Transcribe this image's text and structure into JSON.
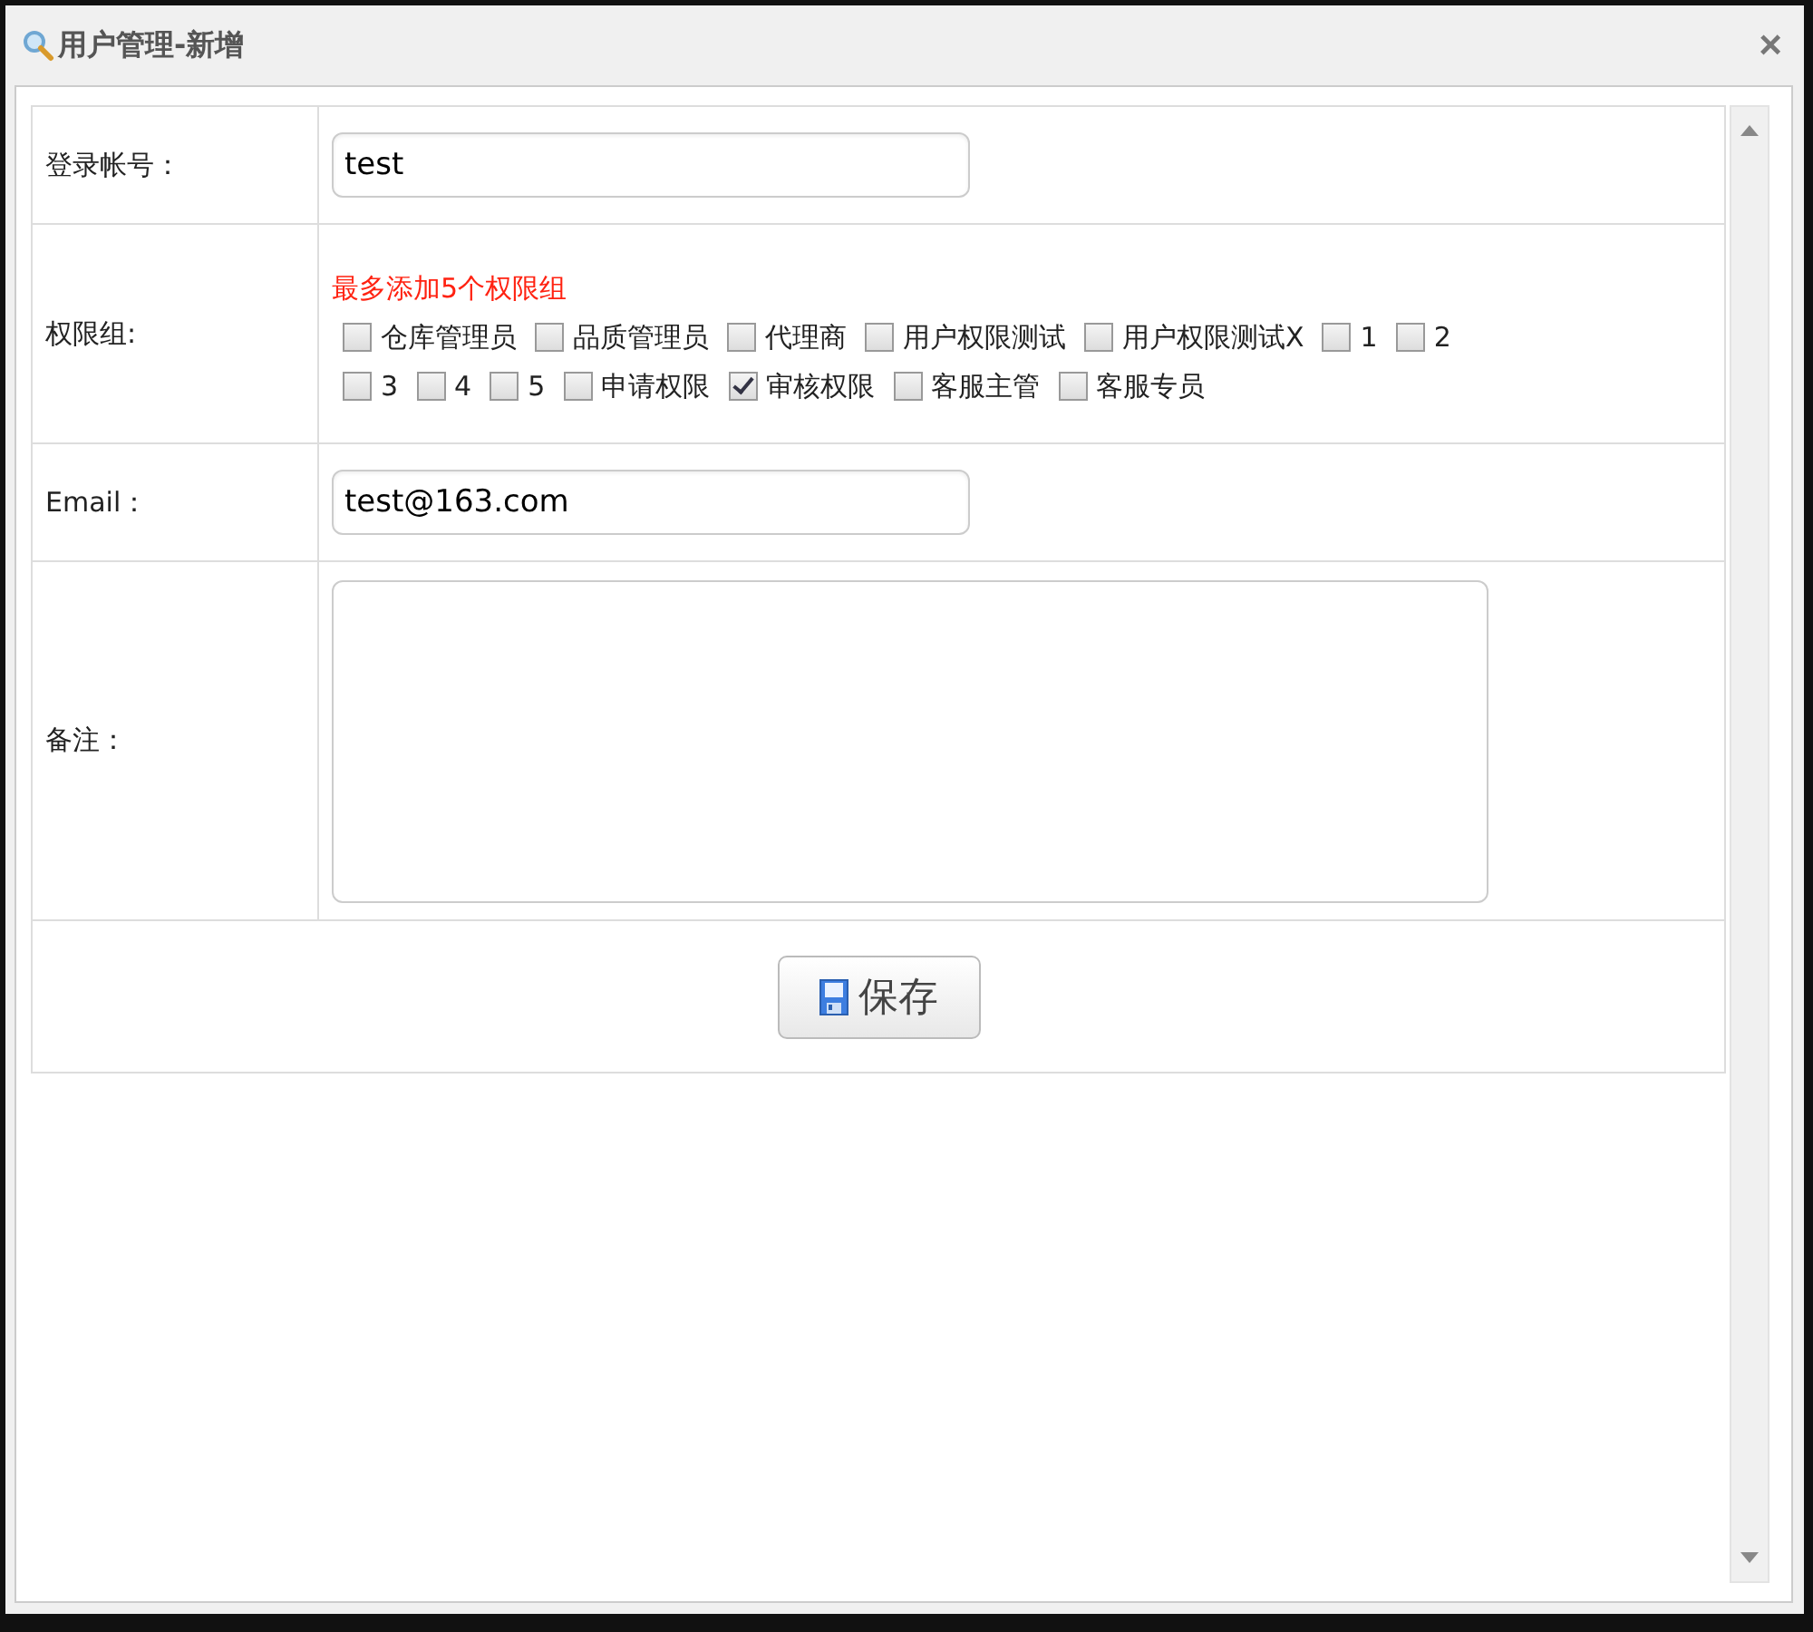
{
  "window": {
    "title": "用户管理-新增",
    "close": "×"
  },
  "form": {
    "account": {
      "label": "登录帐号：",
      "value": "test"
    },
    "groups": {
      "label": "权限组:",
      "hint": "最多添加5个权限组",
      "options": [
        {
          "label": "仓库管理员",
          "checked": false
        },
        {
          "label": "品质管理员",
          "checked": false
        },
        {
          "label": "代理商",
          "checked": false
        },
        {
          "label": "用户权限测试",
          "checked": false
        },
        {
          "label": "用户权限测试X",
          "checked": false
        },
        {
          "label": "1",
          "checked": false
        },
        {
          "label": "2",
          "checked": false
        },
        {
          "label": "3",
          "checked": false
        },
        {
          "label": "4",
          "checked": false
        },
        {
          "label": "5",
          "checked": false
        },
        {
          "label": "申请权限",
          "checked": false
        },
        {
          "label": "审核权限",
          "checked": true
        },
        {
          "label": "客服主管",
          "checked": false
        },
        {
          "label": "客服专员",
          "checked": false
        }
      ]
    },
    "email": {
      "label": "Email：",
      "value": "test@163.com"
    },
    "remark": {
      "label": "备注："
    },
    "save_button": "保存"
  }
}
